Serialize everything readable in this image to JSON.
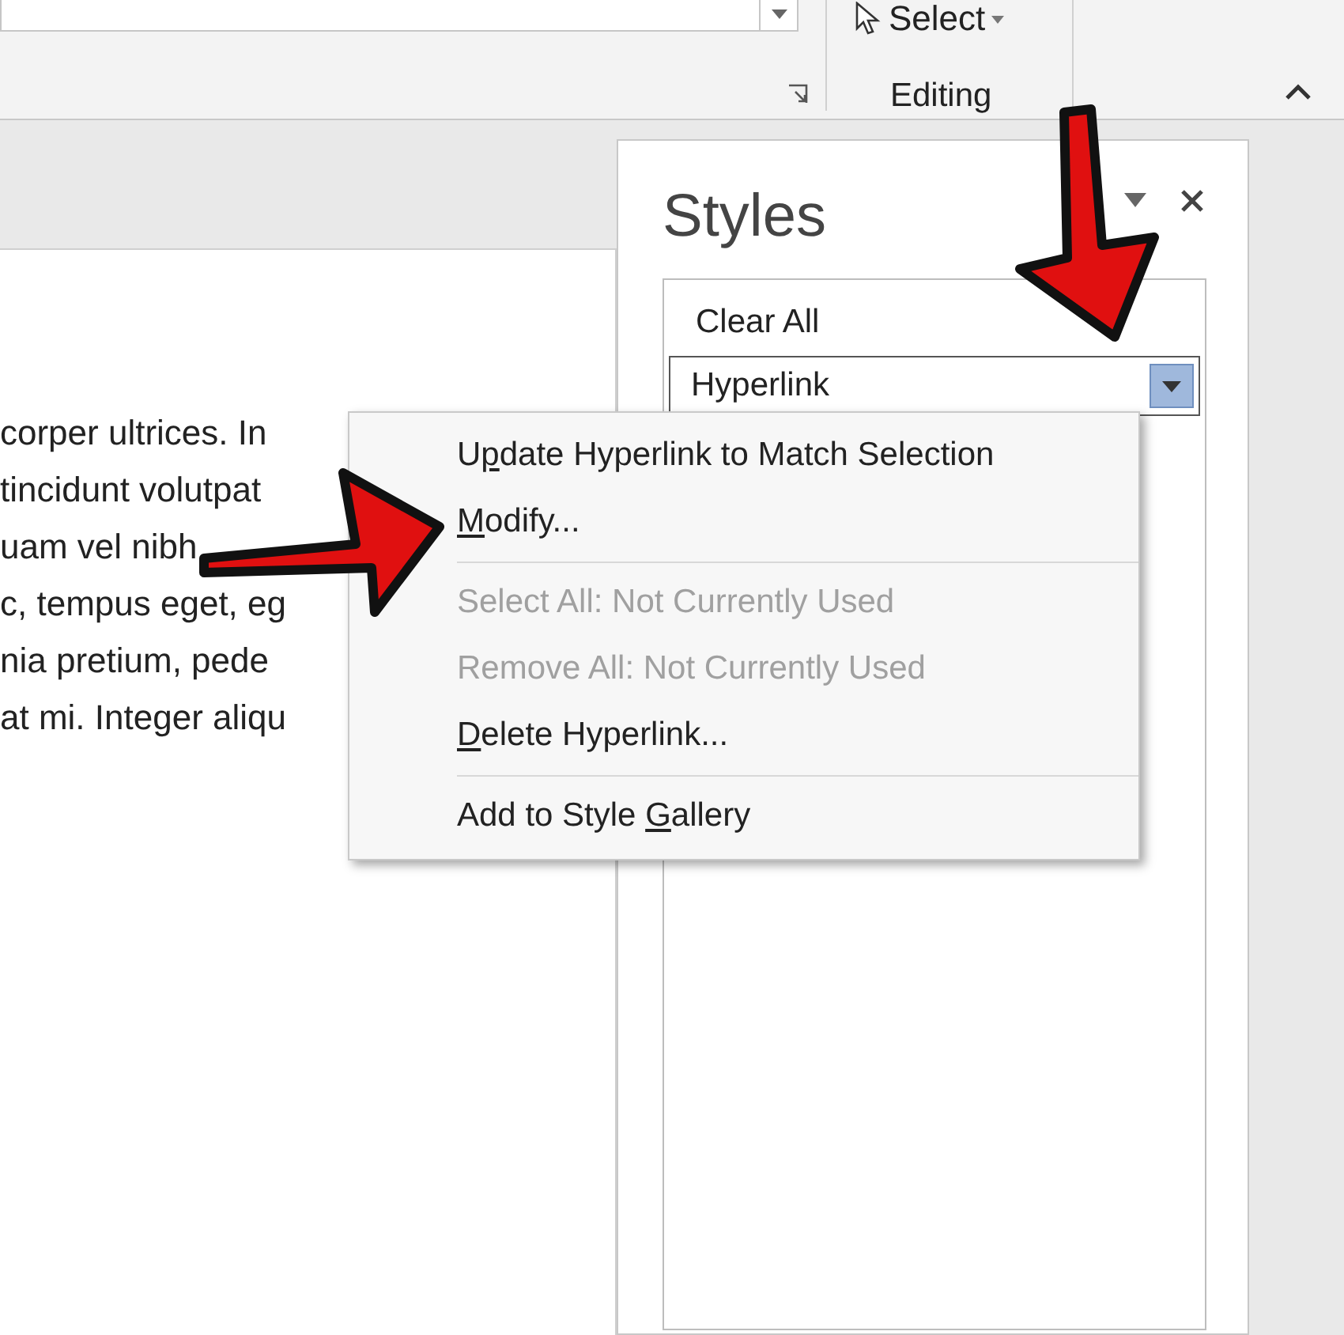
{
  "ribbon": {
    "select_button": "Select",
    "group_label": "Editing"
  },
  "document": {
    "lines": [
      "corper ultrices. In",
      "tincidunt volutpat",
      "uam vel nibh",
      "c, tempus eget, eg",
      "nia pretium, pede",
      "at mi. Integer aliqu"
    ]
  },
  "styles_pane": {
    "title": "Styles",
    "items": [
      {
        "label": "Clear All",
        "selected": false
      },
      {
        "label": "Hyperlink",
        "selected": true
      }
    ]
  },
  "context_menu": [
    {
      "kind": "item",
      "parts": [
        {
          "text": "U"
        },
        {
          "text": "p",
          "underlined": true
        },
        {
          "text": "date Hyperlink to Match Selection"
        }
      ],
      "disabled": false
    },
    {
      "kind": "item",
      "parts": [
        {
          "text": "M",
          "underlined": true
        },
        {
          "text": "odify..."
        }
      ],
      "disabled": false
    },
    {
      "kind": "separator"
    },
    {
      "kind": "item",
      "parts": [
        {
          "text": "Select All: Not Currently Used"
        }
      ],
      "disabled": true
    },
    {
      "kind": "item",
      "parts": [
        {
          "text": "Remove All: Not Currently Used"
        }
      ],
      "disabled": true
    },
    {
      "kind": "item",
      "parts": [
        {
          "text": "D",
          "underlined": true
        },
        {
          "text": "elete Hyperlink..."
        }
      ],
      "disabled": false
    },
    {
      "kind": "separator"
    },
    {
      "kind": "item",
      "parts": [
        {
          "text": "Add to Style "
        },
        {
          "text": "G",
          "underlined": true
        },
        {
          "text": "allery"
        }
      ],
      "disabled": false
    }
  ]
}
